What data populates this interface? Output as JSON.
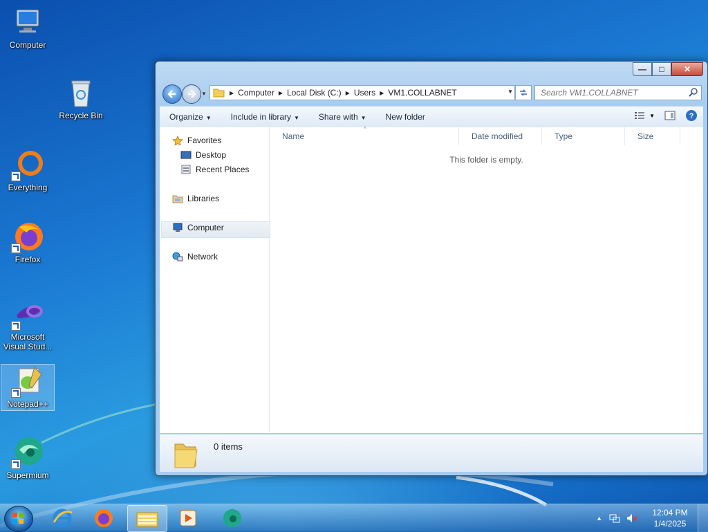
{
  "desktop": {
    "icons": [
      {
        "label": "Computer",
        "icon": "computer-icon"
      },
      {
        "label": "Recycle Bin",
        "icon": "recycle-bin-icon"
      },
      {
        "label": "Everything",
        "icon": "everything-icon"
      },
      {
        "label": "Firefox",
        "icon": "firefox-icon"
      },
      {
        "label_line1": "Microsoft",
        "label_line2": "Visual Stud...",
        "icon": "visual-studio-icon"
      },
      {
        "label": "Notepad++",
        "icon": "notepadpp-icon"
      },
      {
        "label": "Supermium",
        "icon": "supermium-icon"
      }
    ]
  },
  "window": {
    "caption": {
      "minimize": "—",
      "maximize": "□",
      "close": "✕"
    },
    "breadcrumb": [
      "Computer",
      "Local Disk (C:)",
      "Users",
      "VM1.COLLABNET"
    ],
    "search_placeholder": "Search VM1.COLLABNET",
    "toolbar": {
      "organize": "Organize",
      "include_in_library": "Include in library",
      "share_with": "Share with",
      "new_folder": "New folder"
    },
    "nav": {
      "favorites": "Favorites",
      "desktop": "Desktop",
      "recent_places": "Recent Places",
      "libraries": "Libraries",
      "computer": "Computer",
      "network": "Network"
    },
    "columns": {
      "name": "Name",
      "date_modified": "Date modified",
      "type": "Type",
      "size": "Size"
    },
    "empty_message": "This folder is empty.",
    "details": {
      "count": "0 items"
    }
  },
  "taskbar": {
    "clock": {
      "time": "12:04 PM",
      "date": "1/4/2025"
    },
    "apps": [
      "internet-explorer-icon",
      "firefox-icon",
      "file-explorer-icon",
      "media-player-icon",
      "supermium-icon"
    ]
  },
  "colors": {
    "accent": "#1a78d2",
    "window_frame": "#a9cdee",
    "close_button": "#c74b3a"
  }
}
